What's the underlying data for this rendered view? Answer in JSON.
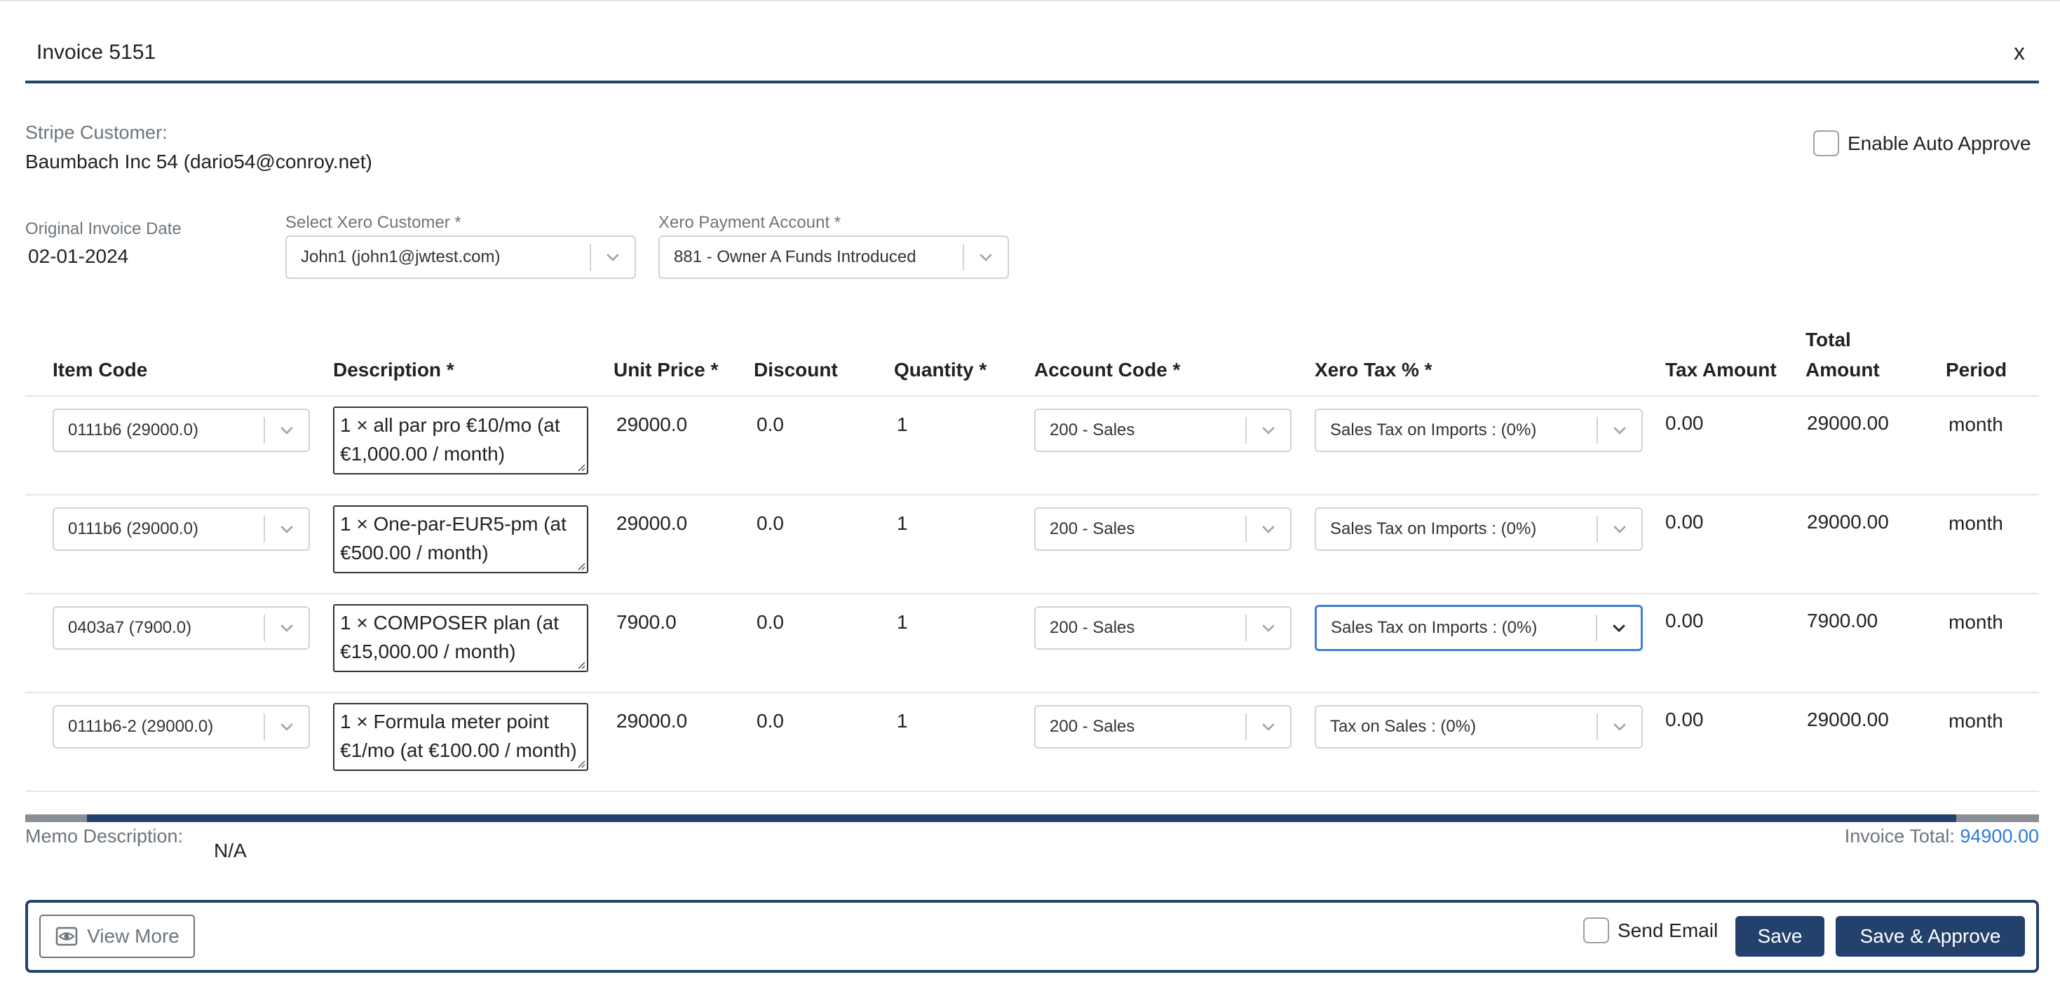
{
  "modal": {
    "title": "Invoice 5151",
    "close_label": "x"
  },
  "stripe_customer": {
    "label": "Stripe Customer:",
    "value": "Baumbach Inc 54 (dario54@conroy.net)"
  },
  "auto_approve": {
    "label": "Enable Auto Approve",
    "checked": false
  },
  "original_invoice_date": {
    "label": "Original Invoice Date",
    "value": "02-01-2024"
  },
  "xero_customer": {
    "label": "Select Xero Customer *",
    "selected": "John1 (john1@jwtest.com)"
  },
  "xero_payment_account": {
    "label": "Xero Payment Account *",
    "selected": "881 - Owner A Funds Introduced"
  },
  "table": {
    "headers": {
      "item_code": "Item Code",
      "description": "Description *",
      "unit_price": "Unit Price *",
      "discount": "Discount",
      "quantity": "Quantity *",
      "account_code": "Account Code *",
      "xero_tax": "Xero Tax % *",
      "tax_amount": "Tax Amount",
      "total_amount_1": "Total",
      "total_amount_2": "Amount",
      "period": "Period"
    },
    "rows": [
      {
        "item_code": "0111b6 (29000.0)",
        "description_1": "1 × all par pro €10/mo (at",
        "description_2": "€1,000.00 / month)",
        "unit_price": "29000.0",
        "discount": "0.0",
        "quantity": "1",
        "account_code": "200 - Sales",
        "xero_tax": "Sales Tax on Imports : (0%)",
        "tax_amount": "0.00",
        "total_amount": "29000.00",
        "period": "month"
      },
      {
        "item_code": "0111b6 (29000.0)",
        "description_1": "1 × One-par-EUR5-pm (at",
        "description_2": "€500.00 / month)",
        "unit_price": "29000.0",
        "discount": "0.0",
        "quantity": "1",
        "account_code": "200 - Sales",
        "xero_tax": "Sales Tax on Imports : (0%)",
        "tax_amount": "0.00",
        "total_amount": "29000.00",
        "period": "month"
      },
      {
        "item_code": "0403a7 (7900.0)",
        "description_1": "1 × COMPOSER plan (at",
        "description_2": "€15,000.00 / month)",
        "unit_price": "7900.0",
        "discount": "0.0",
        "quantity": "1",
        "account_code": "200 - Sales",
        "xero_tax": "Sales Tax on Imports : (0%)",
        "tax_amount": "0.00",
        "total_amount": "7900.00",
        "period": "month"
      },
      {
        "item_code": "0111b6-2 (29000.0)",
        "description_1": "1 × Formula meter point",
        "description_2": "€1/mo (at €100.00 / month)",
        "unit_price": "29000.0",
        "discount": "0.0",
        "quantity": "1",
        "account_code": "200 - Sales",
        "xero_tax": "Tax on Sales : (0%)",
        "tax_amount": "0.00",
        "total_amount": "29000.00",
        "period": "month"
      }
    ]
  },
  "memo": {
    "label": "Memo Description:",
    "value": "N/A"
  },
  "invoice_total": {
    "label": "Invoice Total: ",
    "value": "94900.00"
  },
  "footer": {
    "view_more_label": "View More",
    "send_email_label": "Send Email",
    "send_email_checked": false,
    "save_label": "Save",
    "save_approve_label": "Save & Approve"
  },
  "colors": {
    "brand": "#24416b",
    "focus": "#3d7fd6",
    "link": "#2f7bd8",
    "muted": "#6c757d"
  },
  "icons": [
    "chevron-down-icon",
    "eye-icon",
    "resize-grip-icon"
  ]
}
